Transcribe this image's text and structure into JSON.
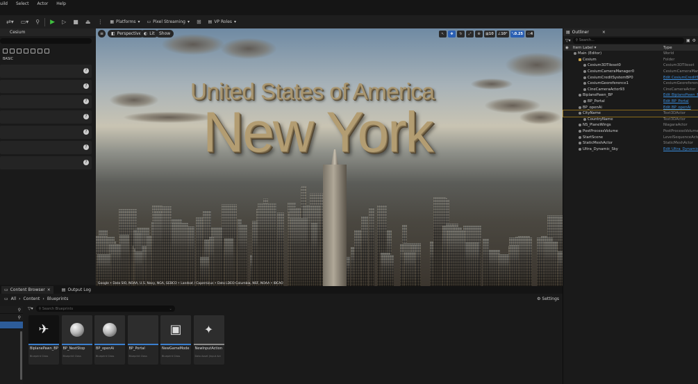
{
  "menu": [
    "uild",
    "Select",
    "Actor",
    "Help"
  ],
  "toolbar": {
    "platforms": "Platforms",
    "pixel_streaming": "Pixel Streaming",
    "vp_roles": "VP Roles"
  },
  "left_panel": {
    "title": "Cesium",
    "section": "BASIC",
    "rows": 7
  },
  "viewport": {
    "perspective": "Perspective",
    "lit": "Lit",
    "show": "Show",
    "grid_val": "10",
    "angle_val": "10°",
    "scale_val": "0.25",
    "cam_val": "4",
    "title_top": "United States of America",
    "title_main": "New York",
    "attribution": "Google • Data SIO, NOAA, U.S. Navy, NGA, GEBCO • Landsat / Copernicus • Data LDEO-Columbia, NSF, NOAA • IBCAO"
  },
  "outliner": {
    "tab": "Outliner",
    "search_placeholder": "Search...",
    "col_label": "Item Label ▾",
    "col_type": "Type",
    "rows": [
      {
        "name": "Main (Editor)",
        "type": "World",
        "indent": 1,
        "link": false
      },
      {
        "name": "Cesium",
        "type": "Folder",
        "indent": 2,
        "link": false
      },
      {
        "name": "Cesium3DTileset0",
        "type": "Cesium3DTileset",
        "indent": 3,
        "link": false
      },
      {
        "name": "CesiumCameraManager0",
        "type": "CesiumCameraMan",
        "indent": 3,
        "link": false
      },
      {
        "name": "CesiumCreditSystemBP0",
        "type": "Edit CesiumCreditSy",
        "indent": 3,
        "link": true
      },
      {
        "name": "CesiumGeoreference1",
        "type": "CesiumGeoreferenc",
        "indent": 3,
        "link": false
      },
      {
        "name": "CineCameraActor93",
        "type": "CineCameraActor",
        "indent": 3,
        "link": false
      },
      {
        "name": "BiplanePawn_BP",
        "type": "Edit BiplanePawn_B",
        "indent": 2,
        "link": true
      },
      {
        "name": "BP_Portal",
        "type": "Edit BP_Portal",
        "indent": 3,
        "link": true
      },
      {
        "name": "BP_openAi",
        "type": "Edit BP_openAi",
        "indent": 2,
        "link": true
      },
      {
        "name": "CityName",
        "type": "Text3DActor",
        "indent": 2,
        "link": false,
        "selected": true
      },
      {
        "name": "CountryName",
        "type": "Text3DActor",
        "indent": 3,
        "link": false
      },
      {
        "name": "NS_PlaneWings",
        "type": "NiagaraActor",
        "indent": 2,
        "link": false
      },
      {
        "name": "PostProcessVolume",
        "type": "PostProcessVolume",
        "indent": 2,
        "link": false
      },
      {
        "name": "StartScene",
        "type": "LevelSequenceActo",
        "indent": 2,
        "link": false
      },
      {
        "name": "StaticMeshActor",
        "type": "StaticMeshActor",
        "indent": 2,
        "link": false
      },
      {
        "name": "Ultra_Dynamic_Sky",
        "type": "Edit Ultra_Dynamic_",
        "indent": 2,
        "link": true
      }
    ]
  },
  "bottom": {
    "tab_cb": "Content Browser",
    "tab_log": "Output Log",
    "path": [
      "All",
      "Content",
      "Blueprints"
    ],
    "settings": "Settings",
    "search_placeholder": "Search Blueprints",
    "assets": [
      {
        "name": "BiplanePawn_BP",
        "type": "Blueprint Class"
      },
      {
        "name": "BP_NextStop",
        "type": "Blueprint Class"
      },
      {
        "name": "BP_openAi",
        "type": "Blueprint Class"
      },
      {
        "name": "BP_Portal",
        "type": "Blueprint Class"
      },
      {
        "name": "NewGameMode",
        "type": "Blueprint Class"
      },
      {
        "name": "NewInputAction",
        "type": "Data Asset (Input Act"
      }
    ]
  }
}
